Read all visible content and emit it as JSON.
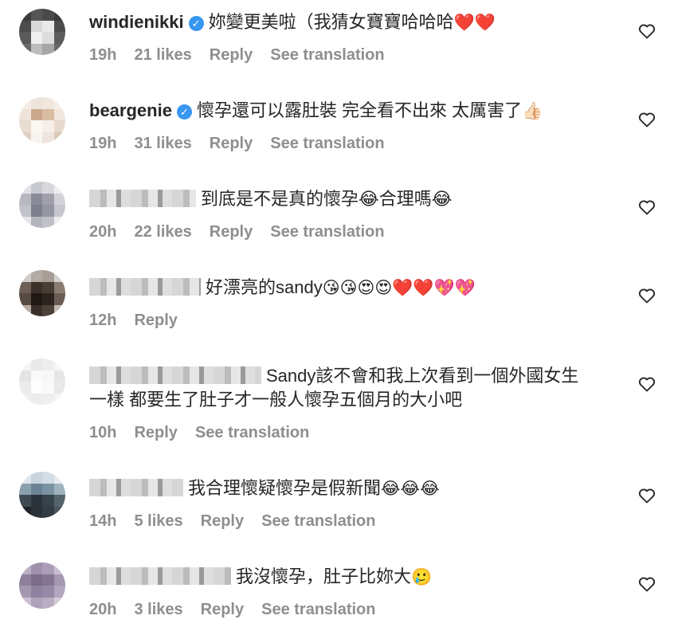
{
  "comments": [
    {
      "user": "windienikki",
      "verified": true,
      "text": "妳變更美啦（我猜女寶寶哈哈哈",
      "emoji": "❤️❤️",
      "time": "19h",
      "likes": "21 likes",
      "reply": "Reply",
      "translate": "See translation"
    },
    {
      "user": "beargenie",
      "verified": true,
      "text": "懷孕還可以露肚裝 完全看不出來 太厲害了",
      "emoji": "👍🏻",
      "time": "19h",
      "likes": "31 likes",
      "reply": "Reply",
      "translate": "See translation"
    },
    {
      "user": "",
      "verified": false,
      "text": "到底是不是真的懷孕😂合理嗎😂",
      "emoji": "",
      "time": "20h",
      "likes": "22 likes",
      "reply": "Reply",
      "translate": "See translation"
    },
    {
      "user": "",
      "verified": false,
      "text": "好漂亮的sandy",
      "emoji": "😘😘😍😍❤️❤️💖💖",
      "time": "12h",
      "likes": "",
      "reply": "Reply",
      "translate": ""
    },
    {
      "user": "",
      "verified": false,
      "text": "Sandy該不會和我上次看到一個外國女生",
      "text2": "一樣 都要生了肚子才一般人懷孕五個月的大小吧",
      "emoji": "",
      "time": "10h",
      "likes": "",
      "reply": "Reply",
      "translate": "See translation"
    },
    {
      "user": "",
      "verified": false,
      "text": "我合理懷疑懷孕是假新聞",
      "emoji": "😂😂😂",
      "time": "14h",
      "likes": "5 likes",
      "reply": "Reply",
      "translate": "See translation"
    },
    {
      "user": "",
      "verified": false,
      "text": "我沒懷孕，肚子比妳大",
      "emoji": "🥲",
      "time": "20h",
      "likes": "3 likes",
      "reply": "Reply",
      "translate": "See translation"
    }
  ],
  "icons": {
    "verified": "verified-badge-icon",
    "heart": "heart-outline-icon"
  },
  "colors": {
    "text": "#262626",
    "meta": "#8e8e8e",
    "verified": "#3897f0"
  }
}
